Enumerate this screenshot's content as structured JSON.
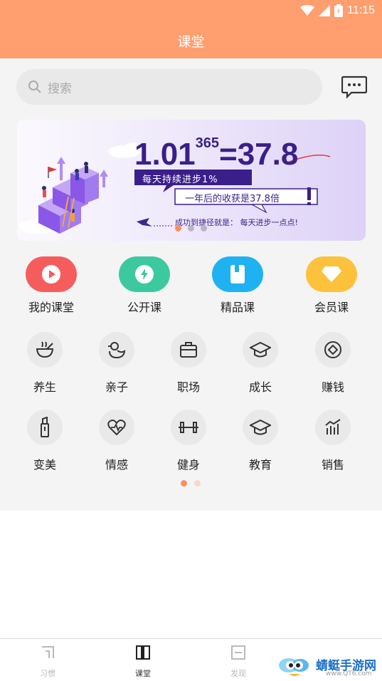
{
  "status": {
    "time": "11:15"
  },
  "header": {
    "title": "课堂"
  },
  "search": {
    "placeholder": "搜索"
  },
  "banner": {
    "formula": "1.01",
    "exponent": "365",
    "result": "=37.8",
    "line1": "每天持续进步1%",
    "line2": "一年后的收获是37.8倍",
    "line3": "成功到捷径就是：  每天进步一点点!"
  },
  "main_categories": [
    {
      "label": "我的课堂",
      "color": "#f55d5d",
      "icon": "play-icon"
    },
    {
      "label": "公开课",
      "color": "#3cc9a0",
      "icon": "lightning-icon"
    },
    {
      "label": "精品课",
      "color": "#1fb2f2",
      "icon": "book-icon"
    },
    {
      "label": "会员课",
      "color": "#fcc23c",
      "icon": "diamond-icon"
    }
  ],
  "sub_categories_row1": [
    {
      "label": "养生",
      "icon": "bowl-icon"
    },
    {
      "label": "亲子",
      "icon": "duck-icon"
    },
    {
      "label": "职场",
      "icon": "briefcase-icon"
    },
    {
      "label": "成长",
      "icon": "graduation-cap-icon"
    },
    {
      "label": "赚钱",
      "icon": "coin-icon"
    }
  ],
  "sub_categories_row2": [
    {
      "label": "变美",
      "icon": "lipstick-icon"
    },
    {
      "label": "情感",
      "icon": "heart-pulse-icon"
    },
    {
      "label": "健身",
      "icon": "dumbbell-icon"
    },
    {
      "label": "教育",
      "icon": "graduation-cap-icon"
    },
    {
      "label": "销售",
      "icon": "chart-icon"
    }
  ],
  "bottom_nav": [
    {
      "label": "习惯",
      "icon": "habit-icon",
      "active": false
    },
    {
      "label": "课堂",
      "icon": "classroom-icon",
      "active": true
    },
    {
      "label": "发现",
      "icon": "discover-icon",
      "active": false
    }
  ],
  "watermark": {
    "text": "蜻蜓手游网",
    "url": "www.QT6.com"
  },
  "colors": {
    "accent": "#ff9e6e",
    "background": "#f4f4f4"
  }
}
